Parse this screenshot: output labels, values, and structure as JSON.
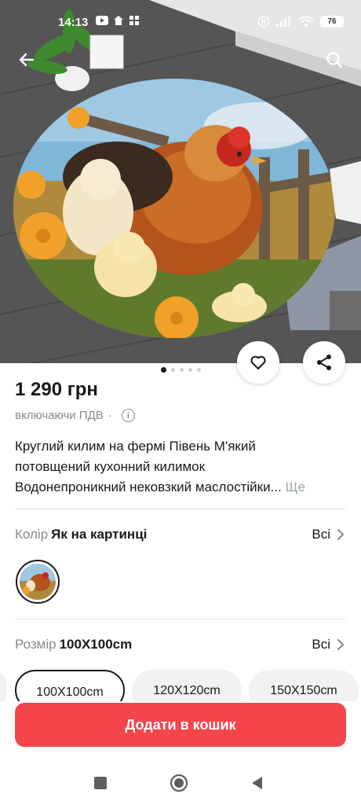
{
  "status_bar": {
    "time": "14:13",
    "battery": "76"
  },
  "gallery": {
    "image_count": 5,
    "active_index": 0
  },
  "product": {
    "price": "1 290 грн",
    "vat_note": "включаючи ПДВ",
    "vat_separator": "·",
    "info_icon_glyph": "i",
    "title_line1": "Круглий килим на фермі Півень М'який",
    "title_line2": "потовщений кухонний килимок",
    "title_line3": "Водонепроникний нековзкий маслостійки...",
    "more_link": "Ще"
  },
  "color_option": {
    "key": "Колір",
    "value": "Як на картинці",
    "all_label": "Всі"
  },
  "size_option": {
    "key": "Розмір",
    "value": "100X100cm",
    "all_label": "Всі",
    "chips": [
      "100X100cm",
      "120X120cm",
      "150X150cm"
    ],
    "selected_index": 0
  },
  "actions": {
    "add_to_cart": "Додати в кошик"
  },
  "colors": {
    "accent": "#f4454b",
    "text": "#191919",
    "muted": "#8a8a8a",
    "link": "#9aa4b0"
  },
  "icons": [
    "back-arrow-icon",
    "search-icon",
    "heart-icon",
    "share-icon",
    "info-icon",
    "chevron-right-icon",
    "square-icon",
    "circle-icon",
    "triangle-back-icon"
  ]
}
